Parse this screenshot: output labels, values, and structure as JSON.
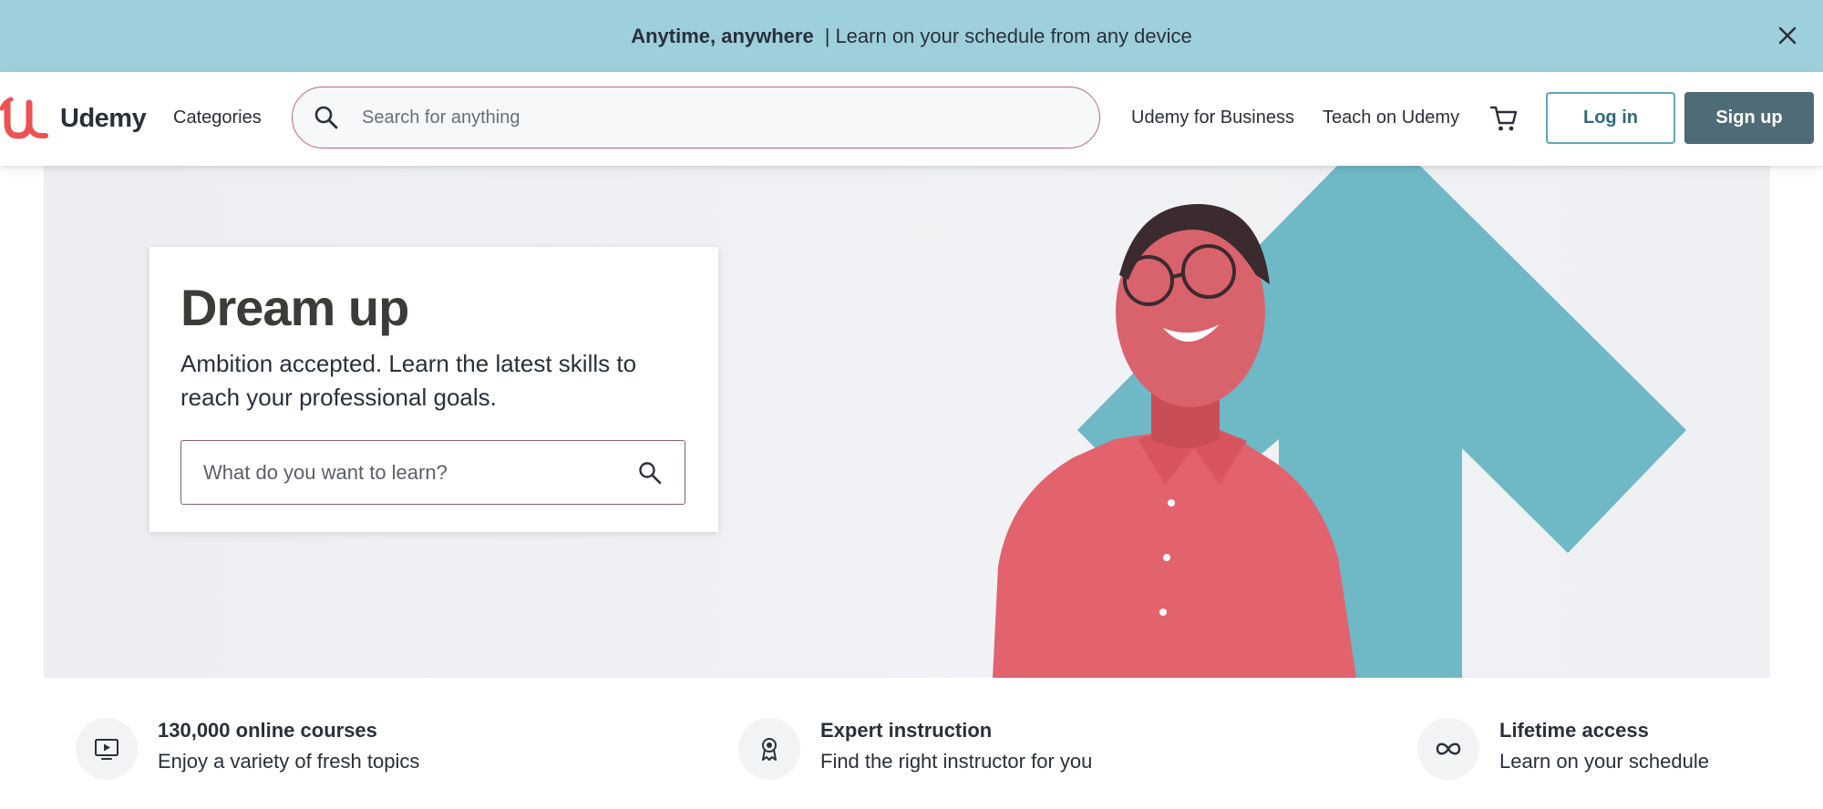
{
  "banner": {
    "bold": "Anytime, anywhere",
    "separator": "|",
    "text": "Learn on your schedule from any device",
    "bg_color": "#9dd0da"
  },
  "header": {
    "logo_text": "Udemy",
    "categories": "Categories",
    "search_placeholder": "Search for anything",
    "business": "Udemy for Business",
    "teach": "Teach on Udemy",
    "login": "Log in",
    "signup": "Sign up",
    "brand_color": "#ec5252"
  },
  "hero": {
    "title": "Dream up",
    "subtitle": "Ambition accepted. Learn the latest skills to reach your professional goals.",
    "search_placeholder": "What do you want to learn?",
    "accent_color": "#6fb8c6"
  },
  "features": [
    {
      "title": "130,000 online courses",
      "desc": "Enjoy a variety of fresh topics",
      "icon": "play-screen-icon"
    },
    {
      "title": "Expert instruction",
      "desc": "Find the right instructor for you",
      "icon": "award-ribbon-icon"
    },
    {
      "title": "Lifetime access",
      "desc": "Learn on your schedule",
      "icon": "infinity-icon"
    }
  ]
}
